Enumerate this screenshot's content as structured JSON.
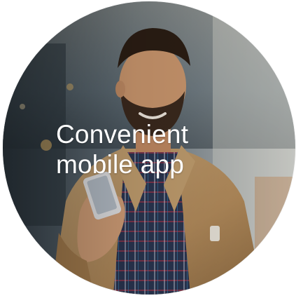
{
  "promo": {
    "caption_line1": "Convenient",
    "caption_line2": "mobile app",
    "image_subject": "man-using-smartphone-photo"
  },
  "colors": {
    "caption_text": "#ffffff",
    "jacket": "#c09a6a",
    "shirt": "#2f3b55",
    "background_street": "#5b6f7c"
  }
}
